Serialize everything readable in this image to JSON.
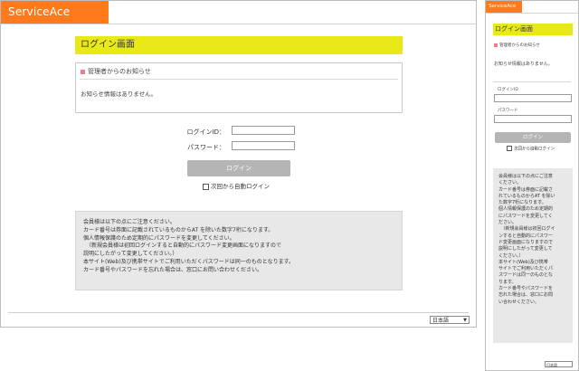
{
  "brand": {
    "logo_text": "ServiceAce",
    "color": "#ff7a1c"
  },
  "page": {
    "title": "ログイン画面",
    "title_bg": "#e9e91a"
  },
  "notice": {
    "heading": "管理者からのお知らせ",
    "body": "お知らせ情報はありません。"
  },
  "form": {
    "login_id_label": "ログインID：",
    "password_label": "パスワード：",
    "login_id_label_mobile": "ログインID",
    "password_label_mobile": "パスワード",
    "login_id_value": "",
    "password_value": "",
    "login_button": "ログイン",
    "auto_login": "次回から自動ログイン",
    "auto_login_checked": false
  },
  "info_lines": [
    "会員様は以下の点にご注意ください。",
    "カード番号は券面に記載されているものからAT を除いた数字7桁になります。",
    "個人情報保護のため定期的にパスワードを変更してください。",
    "　（新規会員様は初回ログインすると自動的にパスワード変更画面になりますので",
    "説明にしたがって変更してください。）",
    "本サイト(Web)及び携帯サイトでご利用いただくパスワードは同一のものとなります。",
    "カード番号やパスワードを忘れた場合は、窓口にお問い合わせください。"
  ],
  "info_lines_mobile": [
    "会員様は以下の点にご注意",
    "ください。",
    "カード番号は券面に記載さ",
    "れているものからAT を除い",
    "た数字7桁になります。",
    "個人情報保護のため定期的",
    "にパスワードを変更してく",
    "ださい。",
    "　（新規会員様は初回ログイ",
    "ンすると自動的にパスワー",
    "ド変更画面になりますので",
    "説明にしたがって変更して",
    "ください。）",
    "本サイト(Web)及び携帯",
    "サイトでご利用いただくパ",
    "スワードは同一のものとな",
    "ります。",
    "カード番号やパスワードを",
    "忘れた場合は、窓口にお問",
    "い合わせください。"
  ],
  "language": {
    "selected": "日本語"
  }
}
